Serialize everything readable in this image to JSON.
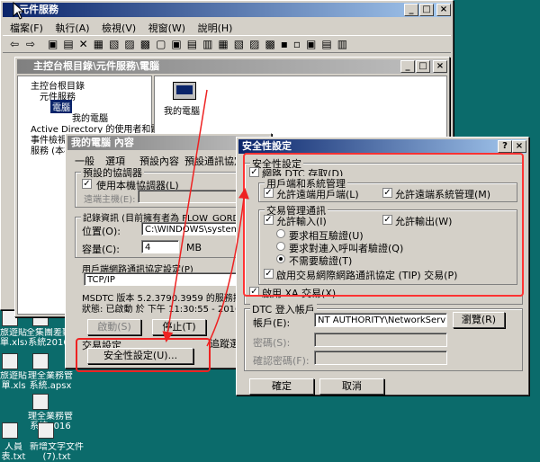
{
  "main_window": {
    "title": "元件服務",
    "menu": [
      "檔案(F)",
      "執行(A)",
      "檢視(V)",
      "視窗(W)",
      "說明(H)"
    ]
  },
  "console_window": {
    "title": "主控台根目錄\\元件服務\\電腦",
    "tree": [
      "主控台根目錄",
      "元件服務",
      "電腦",
      "我的電腦",
      "Active Directory 的使用者和電腦",
      "事件檢視器 (本機)",
      "服務 (本機)"
    ],
    "pane_icon_label": "我的電腦"
  },
  "props_dialog": {
    "title": "我的電腦 內容",
    "tabs": [
      "一般",
      "選項",
      "預設內容",
      "預設通訊協定"
    ],
    "coordinator_group": "預設的協調器",
    "use_local_label": "使用本機協調器(L)",
    "remote_host_label": "遠端主機(E):",
    "log_group": "記錄資訊 (目前擁有者為 FLOW_GORDON)",
    "location_label": "位置(O):",
    "location_value": "C:\\WINDOWS\\system32\\MSD",
    "capacity_label": "容量(C):",
    "capacity_value": "4",
    "capacity_unit": "MB",
    "client_proto_group": "用戶端網路通訊協定設定(P)",
    "client_proto_value": "TCP/IP",
    "msdtc_info": "MSDTC 版本 5.2.3790.3959 的服務控制狀態",
    "status_text": "狀態: 已啟動 於 下午 11:30:55 - 2016/6/24",
    "start_button": "啟動(S)",
    "stop_button": "停止(T)",
    "transaction_group": "交易設定",
    "security_button": "安全性設定(U)...",
    "partial_label": "追蹤選"
  },
  "security_dialog": {
    "title": "安全性設定",
    "security_group": "安全性設定",
    "network_dtc": "網路 DTC 存取(D)",
    "client_admin_group": "用戶端和系統管理",
    "allow_remote_clients": "允許遠端用戶端(L)",
    "allow_remote_admin": "允許遠端系統管理(M)",
    "transaction_manager_group": "交易管理通訊",
    "allow_inbound": "允許輸入(I)",
    "allow_outbound": "允許輸出(W)",
    "mutual_auth": "要求相互驗證(U)",
    "caller_auth": "要求對連入呼叫者驗證(Q)",
    "no_auth": "不需要驗證(T)",
    "tip": "啟用交易網際網路通訊協定 (TIP) 交易(P)",
    "xa": "啟用 XA 交易(X)",
    "logon_group": "DTC 登入帳戶",
    "account_label": "帳戶(E):",
    "account_value": "NT AUTHORITY\\NetworkServi",
    "browse_button": "瀏覽(R)",
    "password_label": "密碼(S):",
    "confirm_label": "確認密碼(F):",
    "ok_button": "確定",
    "cancel_button": "取消"
  },
  "desktop_icons": [
    "旅遊貼單.xlsx",
    "全集團差勤系統2016",
    "旅遊貼單.xls",
    "理全業務管系統.apsx",
    "理全業務管系統2016",
    "人員表.txt",
    "新增文字文件 (7).txt"
  ]
}
